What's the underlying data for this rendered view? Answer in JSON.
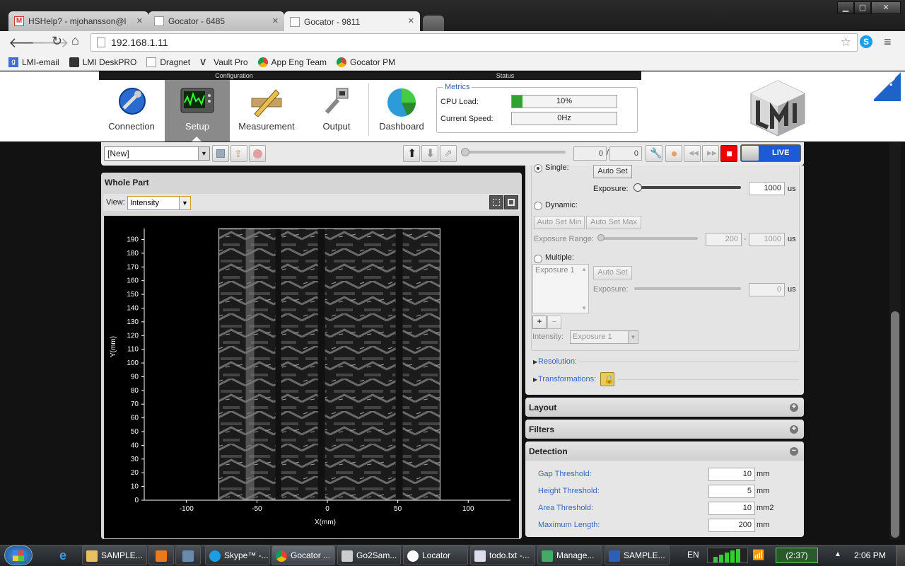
{
  "browser": {
    "tabs": [
      {
        "label": "HSHelp? - mjohansson@l",
        "icon": "gmail-icon"
      },
      {
        "label": "Gocator - 6485",
        "icon": "page-icon"
      },
      {
        "label": "Gocator - 9811",
        "icon": "page-icon"
      }
    ],
    "url": "192.168.1.11",
    "bookmarks": [
      "LMI-email",
      "LMI DeskPRO",
      "Dragnet",
      "Vault Pro",
      "App Eng Team",
      "Gocator PM"
    ]
  },
  "header": {
    "configuration_label": "Configuration",
    "status_label": "Status",
    "nav": [
      {
        "label": "Connection",
        "icon": "globe-wrench-icon"
      },
      {
        "label": "Setup",
        "icon": "monitor-waveform-icon"
      },
      {
        "label": "Measurement",
        "icon": "ruler-pencil-icon"
      },
      {
        "label": "Output",
        "icon": "ethernet-plug-icon"
      },
      {
        "label": "Dashboard",
        "icon": "pie-globe-icon"
      }
    ],
    "metrics_label": "Metrics",
    "cpu_label": "CPU Load:",
    "cpu_value": "10%",
    "cpu_fraction": 0.1,
    "speed_label": "Current Speed:",
    "speed_value": "0Hz",
    "help": "?"
  },
  "controls": {
    "job": "[New]",
    "frame_current": "0",
    "frame_sep": "/",
    "frame_total": "0",
    "live_label": "LIVE"
  },
  "viewer": {
    "title": "Whole Part",
    "view_label": "View:",
    "view_value": "Intensity"
  },
  "chart_data": {
    "type": "heatmap",
    "xlabel": "X(mm)",
    "ylabel": "Y(mm)",
    "xlim": [
      -130,
      130
    ],
    "ylim": [
      0,
      198
    ],
    "xticks": [
      -100,
      -50,
      0,
      50,
      100
    ],
    "yticks": [
      0,
      10,
      20,
      30,
      40,
      50,
      60,
      70,
      80,
      90,
      100,
      110,
      120,
      130,
      140,
      150,
      160,
      170,
      180,
      190
    ],
    "image_extent_x": [
      -77,
      80
    ],
    "image_extent_y": [
      0,
      198
    ],
    "colormap": "grayscale"
  },
  "exposure": {
    "single_label": "Single:",
    "auto_set": "Auto Set",
    "exposure_label": "Exposure:",
    "exposure_value": "1000",
    "unit_us": "us",
    "dynamic_label": "Dynamic:",
    "auto_set_min": "Auto Set Min",
    "auto_set_max": "Auto Set Max",
    "range_label": "Exposure Range:",
    "range_min": "200",
    "range_sep": "-",
    "range_max": "1000",
    "multiple_label": "Multiple:",
    "multi_list_item": "Exposure 1",
    "multi_exposure_value": "0",
    "add": "+",
    "remove": "−",
    "intensity_label": "Intensity:",
    "intensity_value": "Exposure 1",
    "resolution_label": "Resolution:",
    "transformations_label": "Transformations:"
  },
  "sections": {
    "layout": "Layout",
    "filters": "Filters",
    "detection": "Detection"
  },
  "detection": [
    {
      "label": "Gap Threshold:",
      "value": "10",
      "unit": "mm"
    },
    {
      "label": "Height Threshold:",
      "value": "5",
      "unit": "mm"
    },
    {
      "label": "Area Threshold:",
      "value": "10",
      "unit": "mm2"
    },
    {
      "label": "Maximum Length:",
      "value": "200",
      "unit": "mm"
    }
  ],
  "taskbar": {
    "items": [
      "SAMPLE...",
      "",
      "",
      "Skype™ -...",
      "Gocator ...",
      "Go2Sam...",
      "Locator",
      "todo.txt -...",
      "Manage...",
      "SAMPLE..."
    ],
    "lang": "EN",
    "battery": "(2:37)",
    "time": "2:06 PM"
  }
}
